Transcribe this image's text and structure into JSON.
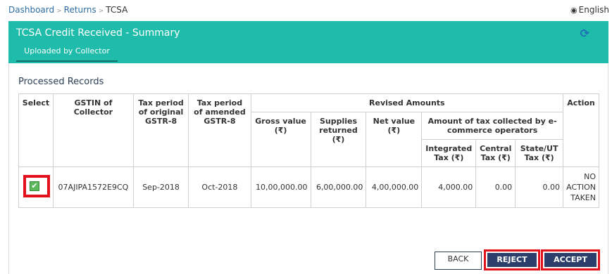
{
  "breadcrumb": {
    "items": [
      "Dashboard",
      "Returns",
      "TCSA"
    ],
    "separator": ">"
  },
  "language": {
    "label": "English",
    "icon": "globe-icon"
  },
  "panel": {
    "title": "TCSA Credit Received - Summary",
    "tab": "Uploaded by Collector",
    "refresh_icon": "refresh-icon",
    "header_color": "#1fbcab"
  },
  "section_title": "Processed Records",
  "table": {
    "headers": {
      "select": "Select",
      "gstin": "GSTIN of Collector",
      "tax_period_original": "Tax period of original GSTR-8",
      "tax_period_amended": "Tax period of amended GSTR-8",
      "revised_amounts": "Revised Amounts",
      "gross_value": "Gross value (₹)",
      "supplies_returned": "Supplies returned (₹)",
      "net_value": "Net value (₹)",
      "tax_collected": "Amount of tax collected by e-commerce operators",
      "integrated_tax": "Integrated Tax (₹)",
      "central_tax": "Central Tax (₹)",
      "state_ut_tax": "State/UT Tax (₹)",
      "action": "Action"
    },
    "rows": [
      {
        "selected": true,
        "gstin": "07AJIPA1572E9CQ",
        "tax_period_original": "Sep-2018",
        "tax_period_amended": "Oct-2018",
        "gross_value": "10,00,000.00",
        "supplies_returned": "6,00,000.00",
        "net_value": "4,00,000.00",
        "integrated_tax": "4,000.00",
        "central_tax": "0.00",
        "state_ut_tax": "0.00",
        "action": "NO ACTION TAKEN"
      }
    ]
  },
  "buttons": {
    "back": "BACK",
    "reject": "REJECT",
    "accept": "ACCEPT"
  },
  "colors": {
    "accent": "#1fbcab",
    "primary_button": "#2b3f6a",
    "highlight": "#e3111b",
    "link": "#2e6da4"
  }
}
